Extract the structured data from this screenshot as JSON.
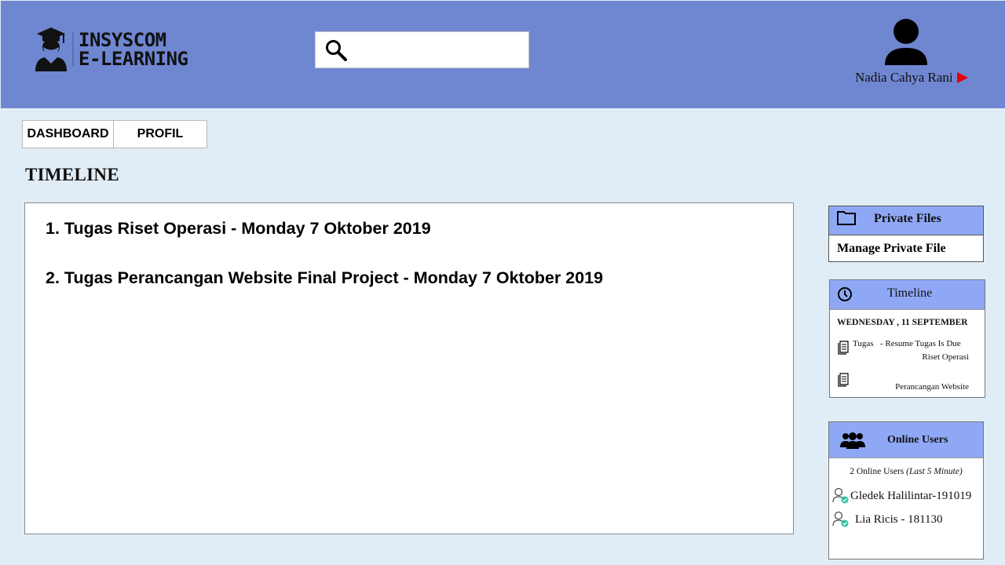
{
  "header": {
    "logo": {
      "line1": "INSYSCOM",
      "line2": "E-LEARNING"
    },
    "search": {
      "placeholder": "",
      "value": ""
    },
    "user": {
      "name": "Nadia Cahya Rani"
    }
  },
  "tabs": [
    {
      "label": "DASHBOARD"
    },
    {
      "label": "PROFIL"
    }
  ],
  "page_title": "TIMELINE",
  "main": {
    "items": [
      "1. Tugas Riset Operasi - Monday 7 Oktober 2019",
      "2. Tugas Perancangan Website Final Project - Monday 7 Oktober 2019"
    ]
  },
  "private_files": {
    "title": "Private Files",
    "link": "Manage Private File"
  },
  "timeline_card": {
    "title": "Timeline",
    "date": "WEDNESDAY , 11 SEPTEMBER",
    "events": [
      {
        "label": "Tugas",
        "text": "- Resume Tugas Is Due",
        "course": "Riset Operasi"
      },
      {
        "label": "",
        "text": "",
        "course": "Perancangan Website"
      }
    ]
  },
  "online_users": {
    "title": "Online Users",
    "count_text": "2 Online Users",
    "count_note": "(Last 5 Minute)",
    "users": [
      {
        "name": "Gledek Halilintar-191019"
      },
      {
        "name": "Lia Ricis - 181130"
      }
    ]
  },
  "colors": {
    "header_bg": "#6f87d1",
    "page_bg": "#e1edf6",
    "card_header": "#8fa8f5",
    "caret": "#e60000",
    "online_check": "#2ec4a8"
  }
}
